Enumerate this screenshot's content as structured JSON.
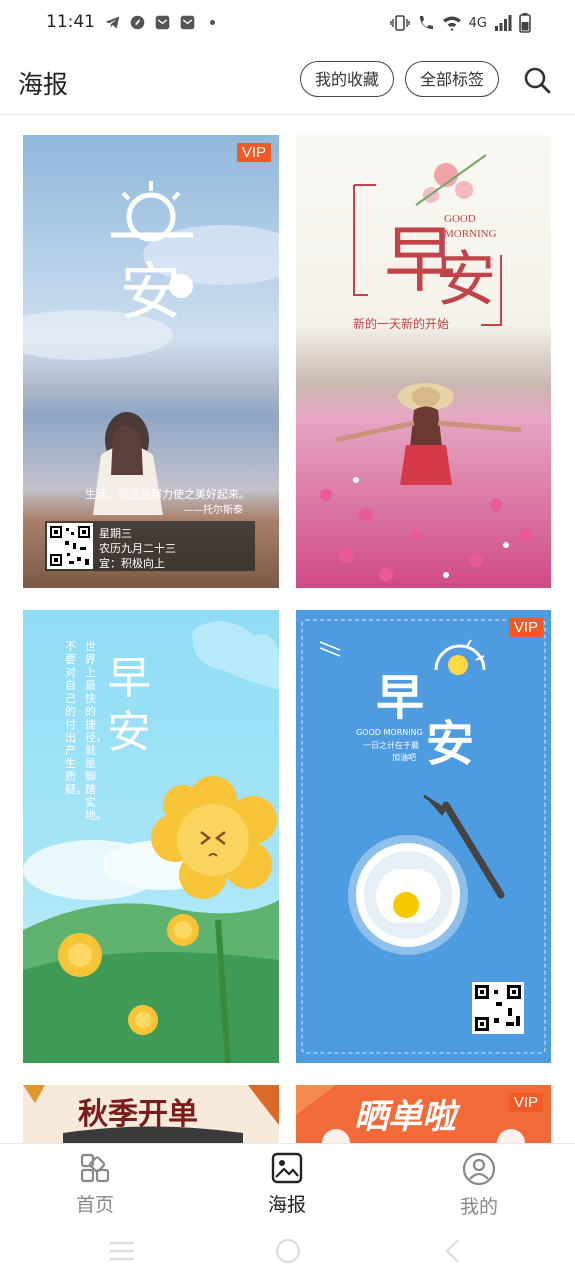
{
  "status_bar": {
    "time": "11:41",
    "network": "4G"
  },
  "header": {
    "title": "海报",
    "favorites_label": "我的收藏",
    "all_tags_label": "全部标签"
  },
  "posters": [
    {
      "vip": "VIP",
      "quote": "生活，就应当努力使之美好起来。",
      "quote_author": "——托尔斯泰",
      "weekday": "星期三",
      "lunar_date": "农历九月二十三",
      "suggestion": "宜：积极向上"
    },
    {
      "title_en_1": "GOOD",
      "title_en_2": "MORNING",
      "subtitle": "新的一天新的开始"
    },
    {
      "title_1": "早",
      "title_2": "安",
      "vertical_1": "世界上最快的捷径，就是脚踏实地。",
      "vertical_2": "不要对自己的付出产生质疑。"
    },
    {
      "vip": "VIP",
      "title_1": "早",
      "title_2": "安",
      "good_morning": "GOOD MORNING",
      "slogan_1": "一日之计在于晨",
      "slogan_2": "加油吧"
    },
    {
      "title": "秋季开单"
    },
    {
      "vip": "VIP",
      "title": "晒单啦"
    }
  ],
  "bottom_nav": {
    "home": "首页",
    "poster": "海报",
    "mine": "我的"
  },
  "colors": {
    "vip_badge": "#f05a24",
    "nav_active": "#222222",
    "nav_inactive": "#888888"
  }
}
